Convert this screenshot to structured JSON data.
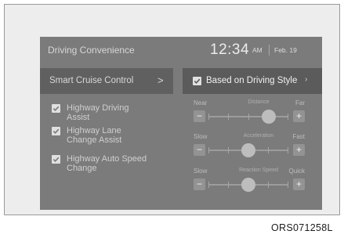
{
  "header": {
    "title": "Driving Convenience",
    "time": "12:34",
    "ampm": "AM",
    "date": "Feb. 19"
  },
  "menu": {
    "label": "Smart Cruise Control",
    "arrow": ">"
  },
  "option": {
    "label": "Based on Driving Style",
    "checked": true,
    "arrow": "›"
  },
  "checks": [
    {
      "label_lines": [
        "Highway Driving",
        "Assist"
      ],
      "checked": true
    },
    {
      "label_lines": [
        "Highway Lane",
        "Change Assist"
      ],
      "checked": true
    },
    {
      "label_lines": [
        "Highway Auto Speed",
        "Change"
      ],
      "checked": true
    }
  ],
  "sliders": [
    {
      "left": "Near",
      "title": "Distance",
      "right": "Far",
      "minus": "−",
      "plus": "+",
      "level": 0.75
    },
    {
      "left": "Slow",
      "title": "Acceleration",
      "right": "Fast",
      "minus": "−",
      "plus": "+",
      "level": 0.5
    },
    {
      "left": "Slow",
      "title": "Reaction Speed",
      "right": "Quick",
      "minus": "−",
      "plus": "+",
      "level": 0.5
    }
  ],
  "caption": "ORS071258L",
  "icons": {
    "checkbox": "checkbox-checked-icon",
    "arrow": "chevron-right-icon"
  }
}
